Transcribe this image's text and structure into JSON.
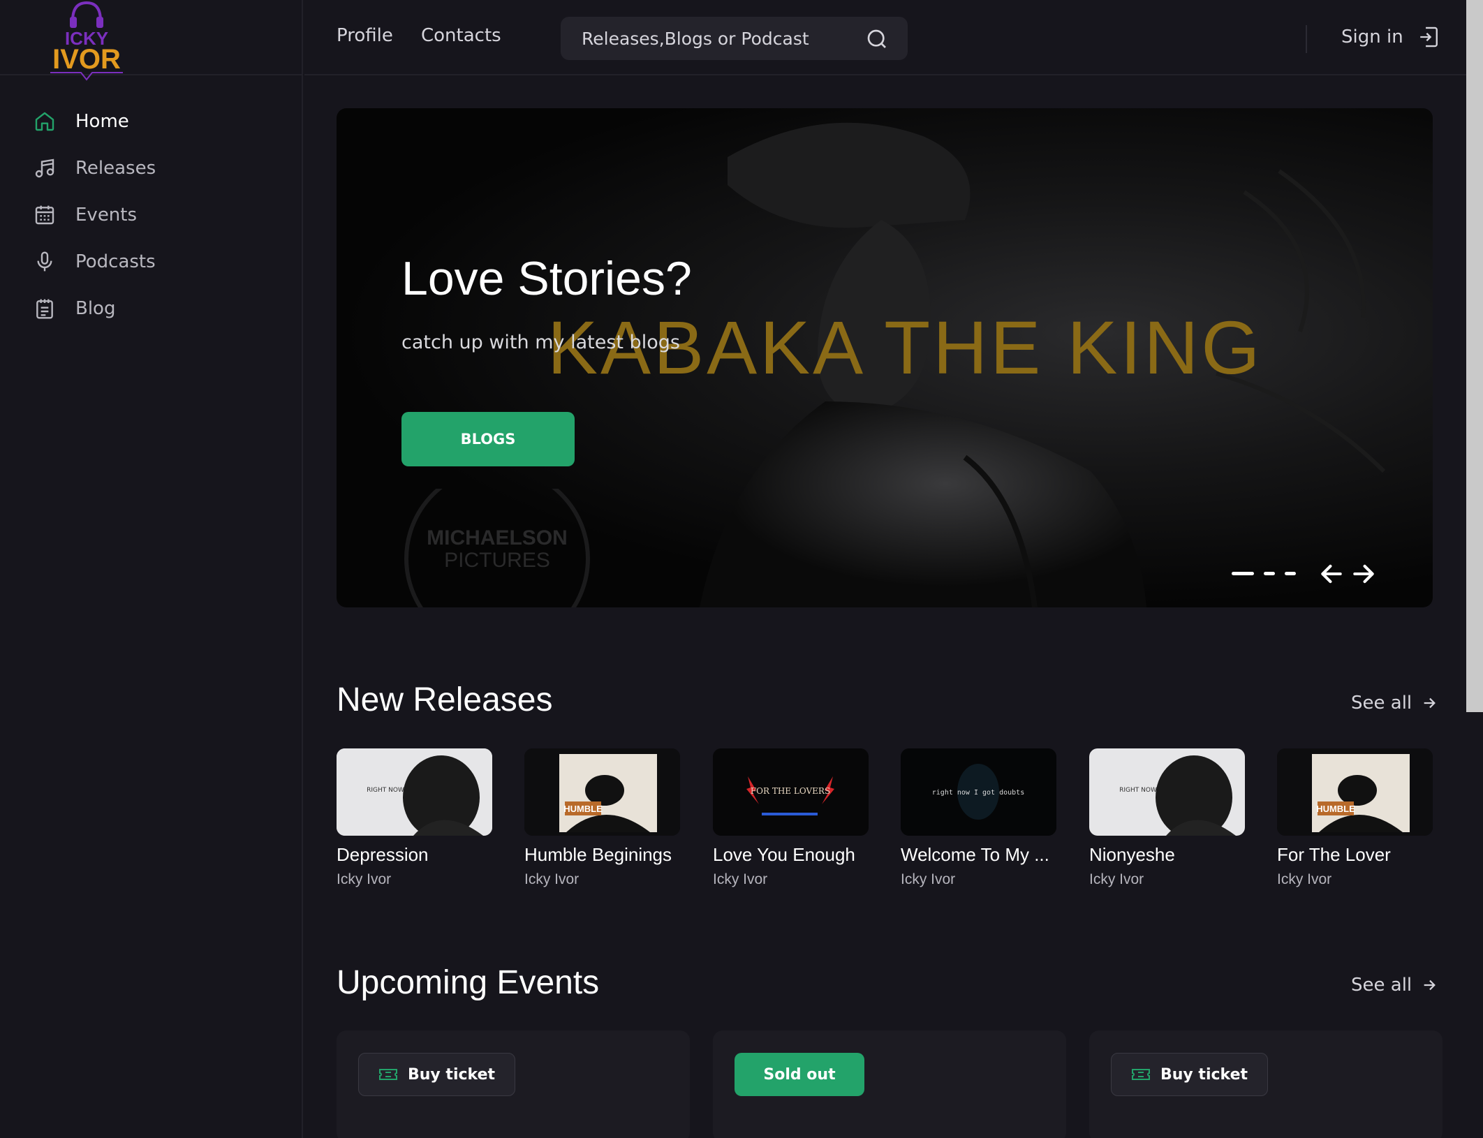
{
  "brand": {
    "logo_top": "ICKY",
    "logo_bottom": "IVOR",
    "accent": "#23a36a",
    "gold": "#e39a1f",
    "purple": "#7b2fbe"
  },
  "sidebar": {
    "items": [
      {
        "label": "Home",
        "icon": "home-icon",
        "active": true
      },
      {
        "label": "Releases",
        "icon": "music-note-icon"
      },
      {
        "label": "Events",
        "icon": "calendar-icon"
      },
      {
        "label": "Podcasts",
        "icon": "microphone-icon"
      },
      {
        "label": "Blog",
        "icon": "notepad-icon"
      }
    ]
  },
  "header": {
    "links": [
      "Profile",
      "Contacts"
    ],
    "search_placeholder": "Releases,Blogs or Podcast",
    "signin_label": "Sign in"
  },
  "hero": {
    "title": "Love Stories?",
    "subtitle": "catch up with my latest blogs",
    "button_label": "BLOGS",
    "background_text": "KABAKA THE KING",
    "watermark_line1": "MICHAELSON",
    "watermark_line2": "PICTURES",
    "slides_total": 3,
    "active_slide": 1
  },
  "releases": {
    "title": "New Releases",
    "see_all": "See all",
    "items": [
      {
        "title": "Depression",
        "artist": "Icky Ivor",
        "thumb_text": "RIGHT NOW"
      },
      {
        "title": "Humble Beginings",
        "artist": "Icky Ivor",
        "thumb_text": "HUMBLE"
      },
      {
        "title": "Love You Enough",
        "artist": "Icky Ivor",
        "thumb_text": "FOR THE LOVERS"
      },
      {
        "title": "Welcome To My ...",
        "artist": "Icky Ivor",
        "thumb_text": "right now I got doubts"
      },
      {
        "title": "Nionyeshe",
        "artist": "Icky Ivor",
        "thumb_text": "RIGHT NOW"
      },
      {
        "title": "For The Lover",
        "artist": "Icky Ivor",
        "thumb_text": "HUMBLE"
      }
    ]
  },
  "events": {
    "title": "Upcoming Events",
    "see_all": "See all",
    "items": [
      {
        "button": "Buy ticket",
        "status": "available"
      },
      {
        "button": "Sold out",
        "status": "sold-out"
      },
      {
        "button": "Buy ticket",
        "status": "available"
      }
    ]
  }
}
